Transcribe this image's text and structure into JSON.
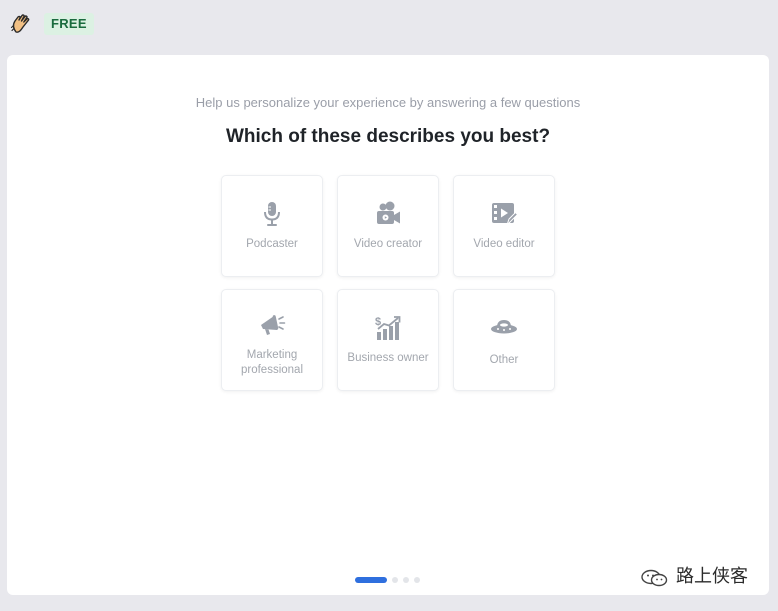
{
  "header": {
    "logo_icon": "hand-wave-icon",
    "plan_badge": "FREE"
  },
  "onboarding": {
    "subtitle": "Help us personalize your experience by answering a few questions",
    "title": "Which of these describes you best?",
    "options": [
      {
        "label": "Podcaster",
        "icon": "microphone-icon"
      },
      {
        "label": "Video creator",
        "icon": "video-camera-icon"
      },
      {
        "label": "Video editor",
        "icon": "film-edit-icon"
      },
      {
        "label": "Marketing professional",
        "icon": "megaphone-icon"
      },
      {
        "label": "Business owner",
        "icon": "growth-chart-icon"
      },
      {
        "label": "Other",
        "icon": "ufo-icon"
      }
    ],
    "progress": {
      "current_step": 1,
      "total_steps": 4
    }
  },
  "watermark": {
    "text": "路上侠客",
    "icon": "wechat-icon"
  },
  "colors": {
    "accent": "#2f6fde",
    "badge_bg": "#dcf1e3",
    "badge_text": "#1a6b3e",
    "icon_gray": "#9aa0aa"
  }
}
